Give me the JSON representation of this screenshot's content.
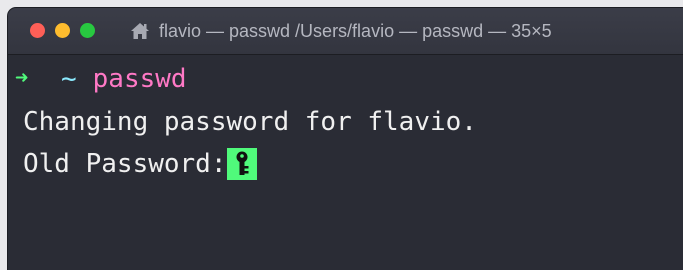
{
  "window": {
    "title": "flavio — passwd /Users/flavio — passwd — 35×5",
    "title_icon": "home-icon"
  },
  "terminal": {
    "prompt_arrow": "➜",
    "prompt_dir": "~",
    "command": "passwd",
    "output_line": "Changing password for flavio.",
    "password_prompt": "Old Password:",
    "cursor_icon": "key-icon"
  },
  "colors": {
    "background": "#2a2c35",
    "prompt_arrow": "#50fa7b",
    "prompt_dir": "#8be9fd",
    "command": "#ff79c6",
    "text": "#f0f0f0",
    "cursor": "#50fa7b"
  }
}
